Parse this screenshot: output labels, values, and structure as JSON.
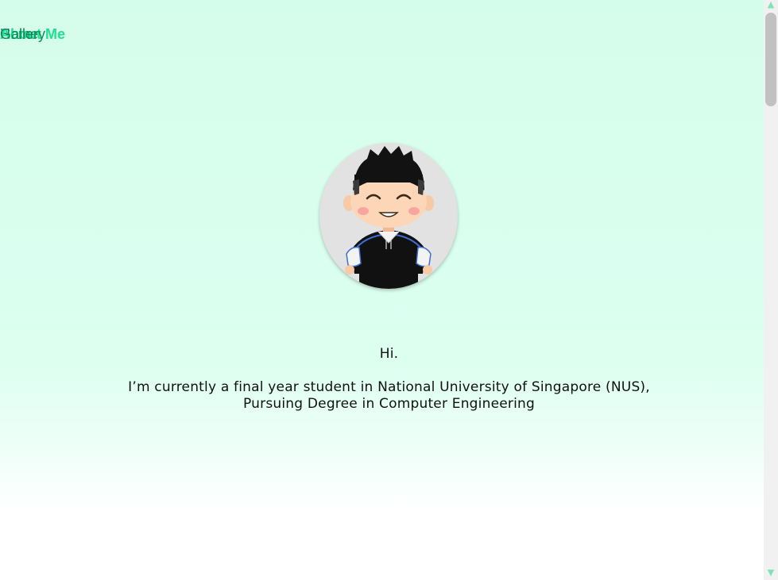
{
  "nav": {
    "items": [
      {
        "label": "Home",
        "active": false
      },
      {
        "label": "About Me",
        "active": true
      },
      {
        "label": "Gallery",
        "active": false
      }
    ]
  },
  "intro": {
    "greeting": "Hi.",
    "line1": "I’m currently a final year student in National University of Singapore (NUS),",
    "line2": "Pursuing Degree in Computer Engineering"
  },
  "colors": {
    "accent": "#1fe08f",
    "nav_text": "#0a8a5c",
    "background_top": "#d5fdec"
  },
  "scrollbar": {
    "up_icon": "triangle-up-icon",
    "down_icon": "triangle-down-icon"
  }
}
